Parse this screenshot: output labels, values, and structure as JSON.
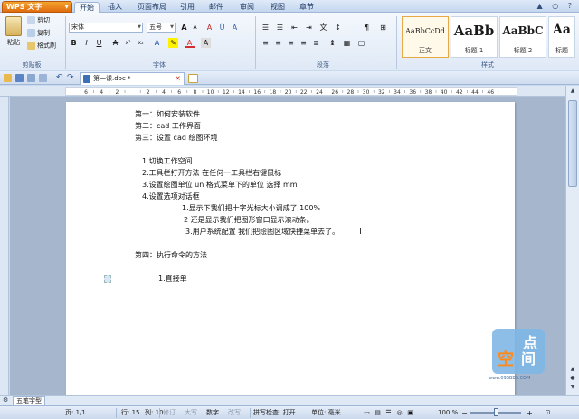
{
  "app": {
    "name": "WPS 文字"
  },
  "menu": {
    "tabs": [
      "开始",
      "插入",
      "页面布局",
      "引用",
      "邮件",
      "审阅",
      "视图",
      "章节"
    ],
    "active": "开始"
  },
  "ribbon": {
    "clipboard": {
      "paste": "粘贴",
      "cut": "剪切",
      "copy": "复制",
      "format_painter": "格式刷",
      "label": "剪贴板"
    },
    "font": {
      "name": "宋体",
      "size": "五号",
      "label": "字体",
      "bold": "B",
      "italic": "I",
      "underline": "U",
      "grow": "A",
      "shrink": "A"
    },
    "paragraph": {
      "label": "段落"
    },
    "styles": {
      "label": "样式",
      "items": [
        {
          "sample": "AaBbCcDd",
          "name": "正文"
        },
        {
          "sample": "AaBb",
          "name": "标题 1"
        },
        {
          "sample": "AaBbC",
          "name": "标题 2"
        },
        {
          "sample": "Aa",
          "name": "标题"
        }
      ]
    }
  },
  "doctab": {
    "title": "第一课.doc *"
  },
  "ruler": {
    "numbers": [
      "6",
      "4",
      "2",
      "",
      "2",
      "4",
      "6",
      "8",
      "10",
      "12",
      "14",
      "16",
      "18",
      "20",
      "22",
      "24",
      "26",
      "28",
      "30",
      "32",
      "34",
      "36",
      "38",
      "40",
      "42",
      "44",
      "46"
    ]
  },
  "document": {
    "lines": [
      "第一：如何安装软件",
      "第二：cad 工作界面",
      "第三：设置 cad 绘图环境",
      "1.切换工作空间",
      "2.工具栏打开方法    在任何一工具栏右键鼠标",
      "3.设置绘图单位    un  格式菜单下的单位   选择 mm",
      "4.设置选项对话框",
      "1.显示下我们把十字光标大小调成了 100%",
      "2  还是显示我们把图形窗口显示滚动条。",
      "3.用户系统配置  我们把绘图区域快捷菜单去了。",
      "第四：执行命令的方法",
      "1.直接单"
    ]
  },
  "watermark": {
    "c1": "点",
    "c2": "空",
    "c3": "间",
    "url": "www.09SBB3.COM"
  },
  "sheettab": {
    "ime": "五笔字型"
  },
  "statusbar": {
    "page": "页: 1/1",
    "row": "行: 15",
    "col": "列: 10",
    "rev": "修订",
    "caps": "大写",
    "num": "数字",
    "ovr": "改写",
    "spell": "拼写检查: 打开",
    "unit": "单位: 毫米",
    "zoom": "100 %"
  },
  "colors": {
    "accent": "#e06d10",
    "ribbon": "#dfe9f6",
    "workspace": "#a6b7cd"
  }
}
